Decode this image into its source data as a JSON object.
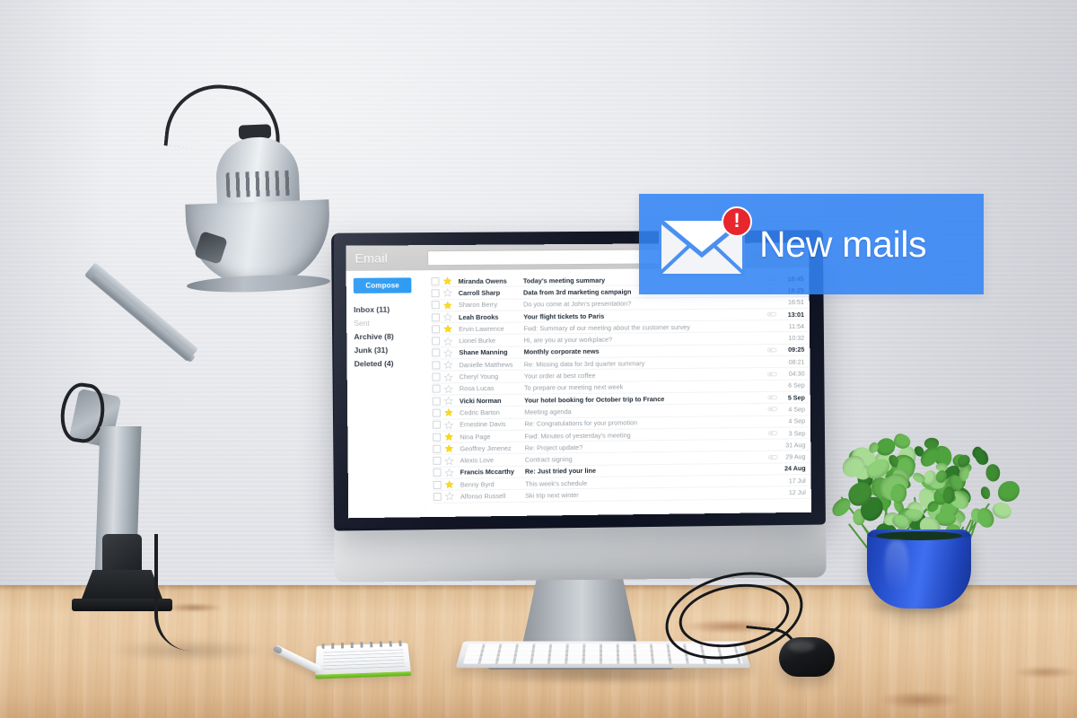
{
  "scene": {
    "objects": {
      "lamp": "desk-lamp",
      "monitor": "desktop-computer-monitor",
      "keyboard": "keyboard",
      "mouse": "mouse",
      "notebook": "spiral-notebook",
      "pen": "pen",
      "plant": "potted-plant"
    }
  },
  "notification": {
    "text": "New mails",
    "badge": "!",
    "icon": "envelope-icon",
    "bg_color": "#3384f5"
  },
  "app": {
    "title": "Email",
    "search": {
      "value": "",
      "placeholder": ""
    },
    "icons": {
      "search": "search-icon",
      "dropdown": "chevron-down-icon",
      "settings": "gear-icon"
    },
    "sidebar": {
      "compose_label": "Compose",
      "folders": [
        {
          "label": "Inbox (11)",
          "muted": false
        },
        {
          "label": "Sent",
          "muted": true
        },
        {
          "label": "Archive (8)",
          "muted": false
        },
        {
          "label": "Junk (31)",
          "muted": false
        },
        {
          "label": "Deleted (4)",
          "muted": false
        }
      ]
    },
    "messages": [
      {
        "from": "Miranda Owens",
        "subject": "Today's meeting summary",
        "time": "18:45",
        "unread": true,
        "starred": true,
        "attachment": true
      },
      {
        "from": "Carroll Sharp",
        "subject": "Data from 3rd marketing campaign",
        "time": "18:25",
        "unread": true,
        "starred": false,
        "attachment": true
      },
      {
        "from": "Sharon Berry",
        "subject": "Do you come at John's presentation?",
        "time": "16:51",
        "unread": false,
        "starred": true,
        "attachment": false
      },
      {
        "from": "Leah Brooks",
        "subject": "Your flight tickets to Paris",
        "time": "13:01",
        "unread": true,
        "starred": false,
        "attachment": true
      },
      {
        "from": "Ervin Lawrence",
        "subject": "Fwd: Summary of our meeting about the customer survey",
        "time": "11:54",
        "unread": false,
        "starred": true,
        "attachment": false
      },
      {
        "from": "Lionel Burke",
        "subject": "Hi, are you at your workplace?",
        "time": "10:32",
        "unread": false,
        "starred": false,
        "attachment": false
      },
      {
        "from": "Shane Manning",
        "subject": "Monthly corporate news",
        "time": "09:25",
        "unread": true,
        "starred": false,
        "attachment": true
      },
      {
        "from": "Danielle Matthews",
        "subject": "Re: Missing data for 3rd quarter summary",
        "time": "08:21",
        "unread": false,
        "starred": false,
        "attachment": false
      },
      {
        "from": "Cheryl Young",
        "subject": "Your order at best coffee",
        "time": "04:30",
        "unread": false,
        "starred": false,
        "attachment": true
      },
      {
        "from": "Rosa Lucas",
        "subject": "To prepare our meeting next week",
        "time": "6 Sep",
        "unread": false,
        "starred": false,
        "attachment": false
      },
      {
        "from": "Vicki Norman",
        "subject": "Your hotel booking for October trip to France",
        "time": "5 Sep",
        "unread": true,
        "starred": false,
        "attachment": true
      },
      {
        "from": "Cedric Barton",
        "subject": "Meeting agenda",
        "time": "4 Sep",
        "unread": false,
        "starred": true,
        "attachment": true
      },
      {
        "from": "Ernestine Davis",
        "subject": "Re: Congratulations for your promotion",
        "time": "4 Sep",
        "unread": false,
        "starred": false,
        "attachment": false
      },
      {
        "from": "Nina Page",
        "subject": "Fwd: Minutes of yesterday's meeting",
        "time": "3 Sep",
        "unread": false,
        "starred": true,
        "attachment": true
      },
      {
        "from": "Geoffrey Jimenez",
        "subject": "Re: Project update?",
        "time": "31 Aug",
        "unread": false,
        "starred": true,
        "attachment": false
      },
      {
        "from": "Alexis Love",
        "subject": "Contract signing",
        "time": "29 Aug",
        "unread": false,
        "starred": false,
        "attachment": true
      },
      {
        "from": "Francis Mccarthy",
        "subject": "Re: Just tried your line",
        "time": "24 Aug",
        "unread": true,
        "starred": false,
        "attachment": false
      },
      {
        "from": "Benny Byrd",
        "subject": "This week's schedule",
        "time": "17 Jul",
        "unread": false,
        "starred": true,
        "attachment": false
      },
      {
        "from": "Alfonso Russell",
        "subject": "Ski trip next winter",
        "time": "12 Jul",
        "unread": false,
        "starred": false,
        "attachment": false
      }
    ]
  }
}
